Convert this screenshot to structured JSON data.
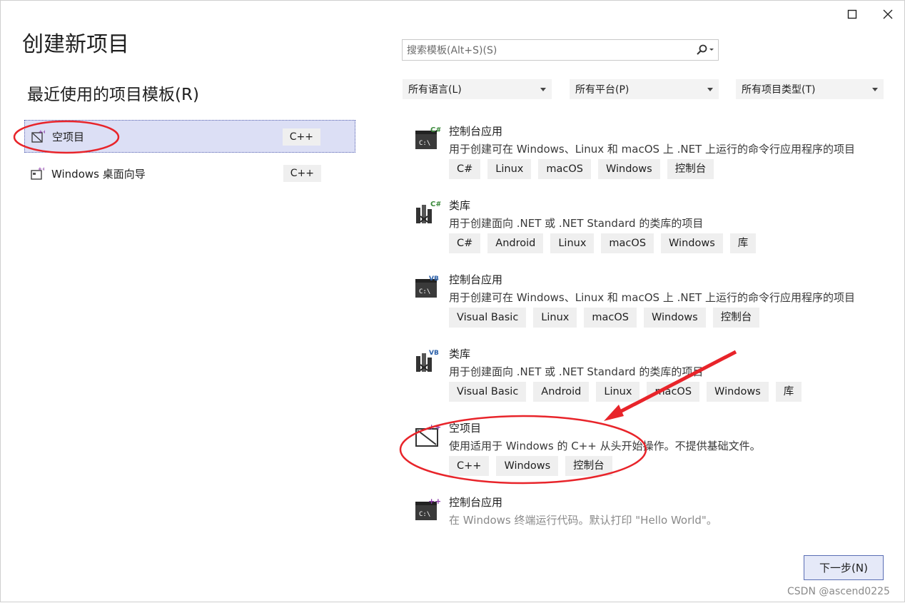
{
  "window": {
    "title": "创建新项目",
    "maximize_glyph": "☐",
    "close_glyph": "✕"
  },
  "recent": {
    "heading": "最近使用的项目模板(R)",
    "items": [
      {
        "label": "空项目",
        "tag": "C++",
        "selected": true
      },
      {
        "label": "Windows 桌面向导",
        "tag": "C++",
        "selected": false
      }
    ]
  },
  "search": {
    "placeholder": "搜索模板(Alt+S)(S)",
    "icon": "search-icon"
  },
  "filters": {
    "language": "所有语言(L)",
    "platform": "所有平台(P)",
    "project_type": "所有项目类型(T)"
  },
  "templates": [
    {
      "name": "控制台应用",
      "badge": "C#",
      "icon": "console-app-icon",
      "desc": "用于创建可在 Windows、Linux 和 macOS 上 .NET 上运行的命令行应用程序的项目",
      "tags": [
        "C#",
        "Linux",
        "macOS",
        "Windows",
        "控制台"
      ]
    },
    {
      "name": "类库",
      "badge": "C#",
      "icon": "class-library-icon",
      "desc": "用于创建面向 .NET 或 .NET Standard 的类库的项目",
      "tags": [
        "C#",
        "Android",
        "Linux",
        "macOS",
        "Windows",
        "库"
      ]
    },
    {
      "name": "控制台应用",
      "badge": "VB",
      "icon": "console-app-icon",
      "desc": "用于创建可在 Windows、Linux 和 macOS 上 .NET 上运行的命令行应用程序的项目",
      "tags": [
        "Visual Basic",
        "Linux",
        "macOS",
        "Windows",
        "控制台"
      ]
    },
    {
      "name": "类库",
      "badge": "VB",
      "icon": "class-library-icon",
      "desc": "用于创建面向 .NET 或 .NET Standard 的类库的项目",
      "tags": [
        "Visual Basic",
        "Android",
        "Linux",
        "macOS",
        "Windows",
        "库"
      ]
    },
    {
      "name": "空项目",
      "badge": "++",
      "icon": "empty-project-icon",
      "desc": "使用适用于 Windows 的 C++ 从头开始操作。不提供基础文件。",
      "tags": [
        "C++",
        "Windows",
        "控制台"
      ]
    },
    {
      "name": "控制台应用",
      "badge": "++",
      "icon": "console-app-icon",
      "desc": "在 Windows 终端运行代码。默认打印 \"Hello World\"。",
      "tags": []
    }
  ],
  "footer": {
    "next_label": "下一步(N)",
    "watermark": "CSDN @ascend0225"
  },
  "colors": {
    "selection_bg": "#dcdff5",
    "accent_blue": "#5a6eb4",
    "annotation_red": "#e8242a",
    "badge_green": "#3b8a3b",
    "badge_blue": "#2a5fa8",
    "badge_purple": "#8a3aa8"
  }
}
